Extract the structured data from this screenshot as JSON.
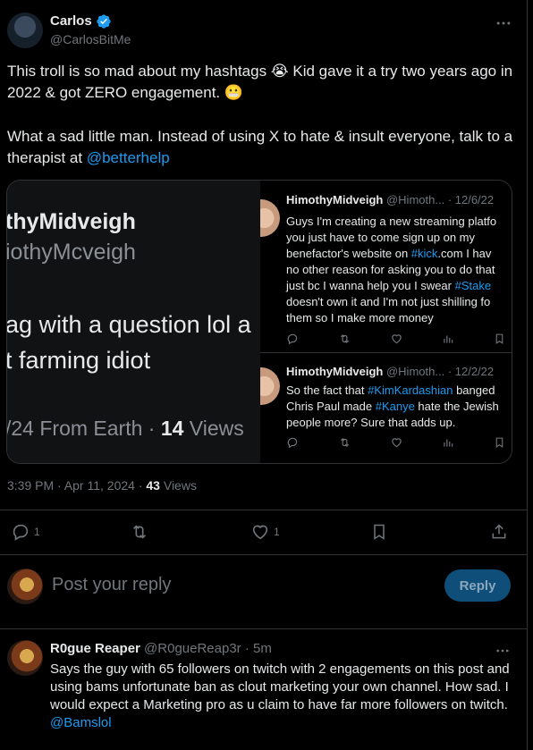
{
  "tweet": {
    "author_name": "Carlos",
    "author_handle": "@CarlosBitMe",
    "paragraph1": "This troll is so mad about my hashtags 😭 Kid gave it a try two years ago in 2022 & got ZERO engagement. 😬",
    "paragraph2_prefix": "What a sad little man. Instead of using X to hate & insult everyone, talk to a therapist at ",
    "paragraph2_mention": "@betterhelp",
    "timestamp": "3:39 PM · Apr 11, 2024 · ",
    "views_count": "43",
    "views_label": " Views",
    "reply_count": "1",
    "like_count": "1",
    "icons": [
      "verified-badge-icon",
      "more-icon",
      "reply-icon",
      "retweet-icon",
      "like-icon",
      "bookmark-icon",
      "share-icon"
    ]
  },
  "media": {
    "left_name": "thyMidveigh",
    "left_handle": "iothyMcveigh",
    "left_line1": "ag with a question lol a",
    "left_line2": "t farming idiot",
    "left_time": "/24 From Earth · ",
    "left_views_num": "14",
    "left_views_label": " Views",
    "mini_tweets": [
      {
        "name": "HimothyMidveigh",
        "handle": "@Himoth...",
        "date": "· 12/6/22",
        "text_parts": [
          {
            "t": "Guys I'm creating a new streaming platfo\nyou just have to come sign up on my\nbenefactor's website on ",
            "link": false
          },
          {
            "t": "#kick",
            "link": true
          },
          {
            "t": ".com I hav\nno other reason for asking you to do that\njust bc I wanna help you I swear ",
            "link": false
          },
          {
            "t": "#Stake",
            "link": true
          },
          {
            "t": "\ndoesn't own it and I'm not just shilling fo\nthem so I make more money",
            "link": false
          }
        ]
      },
      {
        "name": "HimothyMidveigh",
        "handle": "@Himoth...",
        "date": "· 12/2/22",
        "text_parts": [
          {
            "t": "So the fact that ",
            "link": false
          },
          {
            "t": "#KimKardashian",
            "link": true
          },
          {
            "t": " banged\nChris Paul made ",
            "link": false
          },
          {
            "t": "#Kanye",
            "link": true
          },
          {
            "t": " hate the Jewish\npeople more? Sure that adds up.",
            "link": false
          }
        ]
      }
    ]
  },
  "composer": {
    "placeholder": "Post your reply",
    "reply_button": "Reply"
  },
  "comment": {
    "name": "R0gue Reaper",
    "handle": "@R0gueReap3r",
    "time": "· 5m",
    "text": "Says the guy with 65 followers on twitch with 2 engagements on this post and using bams unfortunate ban as clout marketing your own channel. How sad. I would expect a Marketing pro as u claim to have far more followers on twitch. ",
    "mention": "@Bamslol"
  },
  "colors": {
    "background": "#000000",
    "text": "#e7e9ea",
    "muted": "#71767b",
    "accent": "#1d9bf0",
    "divider": "#2f3336"
  }
}
